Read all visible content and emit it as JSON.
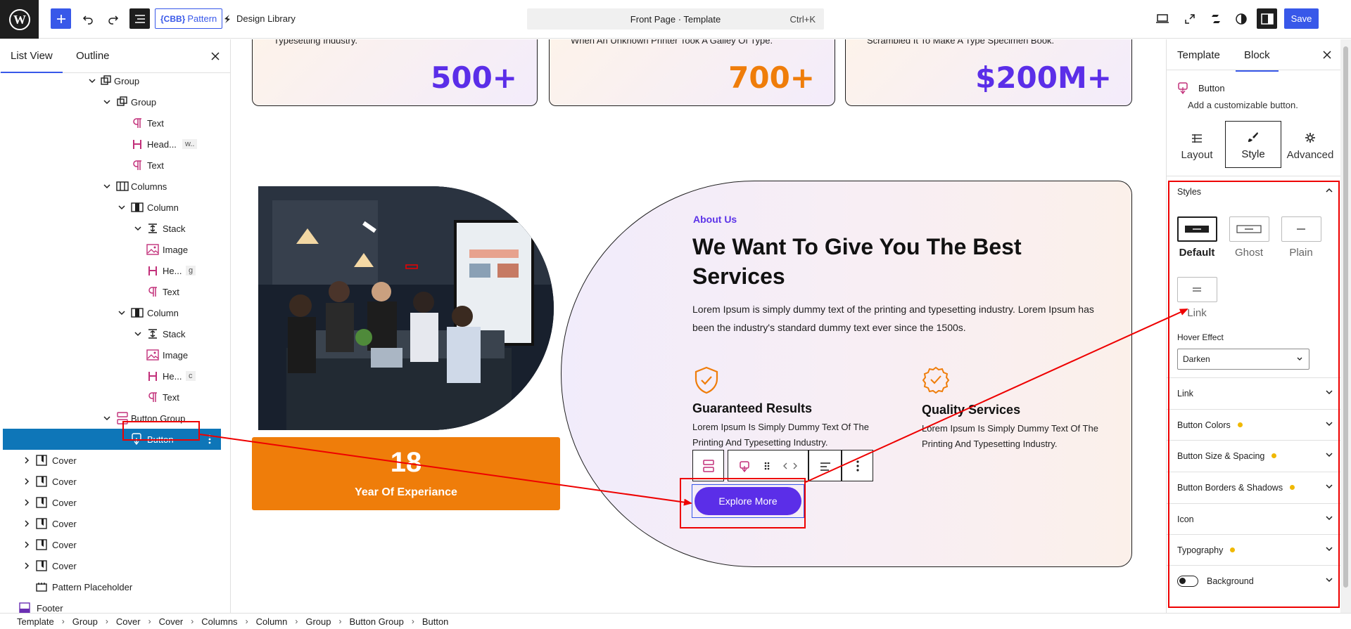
{
  "topbar": {
    "pattern_prefix": "{CBB}",
    "pattern_label": "Pattern",
    "design_library": "Design Library",
    "document_title": "Front Page · Template",
    "shortcut": "Ctrl+K",
    "save": "Save",
    "accent_color": "#3858e9"
  },
  "left_panel": {
    "tab_list_view": "List View",
    "tab_outline": "Outline",
    "tree": [
      {
        "label": "Group",
        "icon": "group-icon"
      },
      {
        "label": "Group",
        "icon": "group-icon"
      },
      {
        "label": "Text",
        "icon": "paragraph-icon"
      },
      {
        "label": "Head...",
        "icon": "heading-icon",
        "tag": "w.."
      },
      {
        "label": "Text",
        "icon": "paragraph-icon"
      },
      {
        "label": "Columns",
        "icon": "columns-icon"
      },
      {
        "label": "Column",
        "icon": "column-icon"
      },
      {
        "label": "Stack",
        "icon": "stack-icon"
      },
      {
        "label": "Image",
        "icon": "image-icon"
      },
      {
        "label": "He...",
        "icon": "heading-icon",
        "tag": "g"
      },
      {
        "label": "Text",
        "icon": "paragraph-icon"
      },
      {
        "label": "Column",
        "icon": "column-icon"
      },
      {
        "label": "Stack",
        "icon": "stack-icon"
      },
      {
        "label": "Image",
        "icon": "image-icon"
      },
      {
        "label": "He...",
        "icon": "heading-icon",
        "tag": "c"
      },
      {
        "label": "Text",
        "icon": "paragraph-icon"
      },
      {
        "label": "Button Group",
        "icon": "button-group-icon"
      },
      {
        "label": "Button",
        "icon": "button-icon",
        "selected": true
      },
      {
        "label": "Cover",
        "icon": "cover-icon"
      },
      {
        "label": "Cover",
        "icon": "cover-icon"
      },
      {
        "label": "Cover",
        "icon": "cover-icon"
      },
      {
        "label": "Cover",
        "icon": "cover-icon"
      },
      {
        "label": "Cover",
        "icon": "cover-icon"
      },
      {
        "label": "Cover",
        "icon": "cover-icon"
      },
      {
        "label": "Pattern Placeholder",
        "icon": "pattern-placeholder-icon"
      },
      {
        "label": "Footer",
        "icon": "footer-icon"
      }
    ]
  },
  "canvas": {
    "stats": [
      {
        "text": "Typesetting Industry.",
        "value": "500+",
        "color": "#5b2ee8"
      },
      {
        "text": "When An Unknown Printer Took A Galley Of Type.",
        "value": "700+",
        "color": "#ef7d0a"
      },
      {
        "text": "Scrambled It To Make A Type Specimen Book.",
        "value": "$200M+",
        "color": "#5b2ee8"
      }
    ],
    "experience_number": "18",
    "experience_label": "Year Of Experiance",
    "about": {
      "eyebrow": "About Us",
      "title": "We Want To Give You The Best Services",
      "text": "Lorem Ipsum is simply dummy text of the printing and typesetting industry. Lorem Ipsum has been the industry's standard dummy text ever since the 1500s."
    },
    "features": [
      {
        "title": "Guaranteed Results",
        "text": "Lorem Ipsum Is Simply Dummy Text Of The Printing And Typesetting Industry.",
        "icon": "shield-check-icon"
      },
      {
        "title": "Quality Services",
        "text": "Lorem Ipsum Is Simply Dummy Text Of The Printing And Typesetting Industry.",
        "icon": "award-badge-icon"
      }
    ],
    "button_label": "Explore More",
    "button_color": "#5b2ee8",
    "orange": "#ef7d0a"
  },
  "right_panel": {
    "tab_template": "Template",
    "tab_block": "Block",
    "block_name": "Button",
    "block_desc": "Add a customizable button.",
    "subtabs": [
      "Layout",
      "Style",
      "Advanced"
    ],
    "styles_heading": "Styles",
    "style_options": [
      "Default",
      "Ghost",
      "Plain",
      "Link"
    ],
    "hover_effect_label": "Hover Effect",
    "hover_effect_value": "Darken",
    "panels": [
      {
        "label": "Link",
        "dot": false
      },
      {
        "label": "Button Colors",
        "dot": true
      },
      {
        "label": "Button Size & Spacing",
        "dot": true
      },
      {
        "label": "Button Borders & Shadows",
        "dot": true
      },
      {
        "label": "Icon",
        "dot": false
      },
      {
        "label": "Typography",
        "dot": true
      },
      {
        "label": "Background",
        "dot": false,
        "toggle": true
      }
    ]
  },
  "breadcrumb": [
    "Template",
    "Group",
    "Cover",
    "Cover",
    "Columns",
    "Column",
    "Group",
    "Button Group",
    "Button"
  ],
  "annotation_color": "#e00000"
}
